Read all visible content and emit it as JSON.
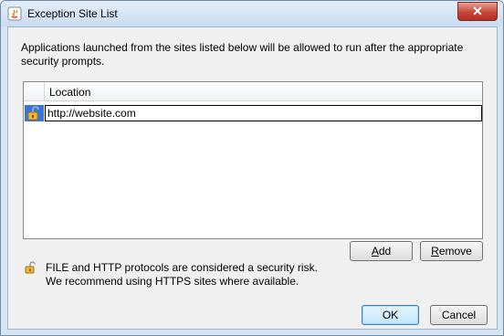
{
  "window": {
    "title": "Exception Site List",
    "close_glyph": "✕"
  },
  "description": "Applications launched from the sites listed below will be allowed to run after the appropriate security prompts.",
  "table": {
    "column_header": "Location",
    "rows": [
      {
        "url": "http://website.com",
        "icon": "unlocked-padlock-icon"
      }
    ]
  },
  "buttons": {
    "add": {
      "mnemonic": "A",
      "rest": "dd"
    },
    "remove": {
      "mnemonic": "R",
      "rest": "emove"
    },
    "ok": "OK",
    "cancel": "Cancel"
  },
  "warning": {
    "line1": "FILE and HTTP protocols are considered a security risk.",
    "line2": "We recommend using HTTPS sites where available."
  },
  "colors": {
    "selection": "#3875d7",
    "close_button": "#c7463a"
  }
}
